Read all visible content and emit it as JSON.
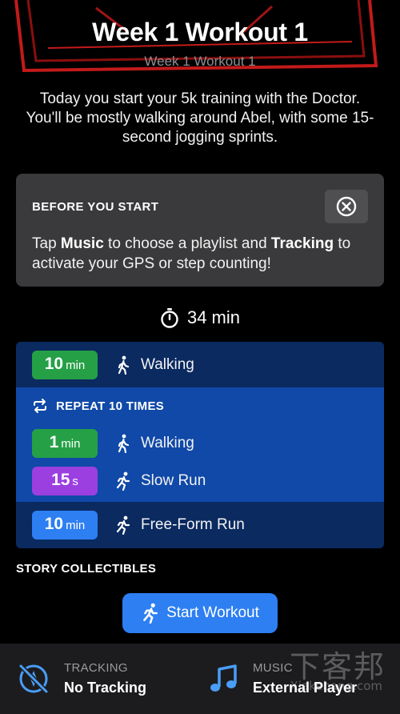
{
  "header": {
    "title": "Week 1 Workout 1",
    "subtitle": "Week 1 Workout 1"
  },
  "intro": "Today you start your 5k training with the Doctor. You'll be mostly walking around Abel, with some 15-second jogging sprints.",
  "before_card": {
    "heading": "BEFORE YOU START",
    "body_1": "Tap ",
    "music": "Music",
    "body_2": " to choose a playlist and ",
    "tracking": "Tracking",
    "body_3": " to activate your GPS or step counting!"
  },
  "duration": "34 min",
  "plan": {
    "warmup": {
      "value": "10",
      "unit": "min",
      "activity": "Walking",
      "color": "#25a046",
      "icon": "walking-icon"
    },
    "repeat_label": "REPEAT 10 TIMES",
    "repeat_items": [
      {
        "value": "1",
        "unit": "min",
        "activity": "Walking",
        "color": "#25a046",
        "icon": "walking-icon"
      },
      {
        "value": "15",
        "unit": "s",
        "activity": "Slow Run",
        "color": "#9b3fe0",
        "icon": "running-icon"
      }
    ],
    "cooldown": {
      "value": "10",
      "unit": "min",
      "activity": "Free-Form Run",
      "color": "#2d7ff2",
      "icon": "running-icon"
    }
  },
  "collectibles_heading": "STORY COLLECTIBLES",
  "start_button": "Start Workout",
  "bottom_bar": {
    "tracking_caption": "TRACKING",
    "tracking_value": "No Tracking",
    "music_caption": "MUSIC",
    "music_value": "External Player"
  },
  "watermark": "下客邦",
  "watermark_sub": "Xiakebang.com"
}
